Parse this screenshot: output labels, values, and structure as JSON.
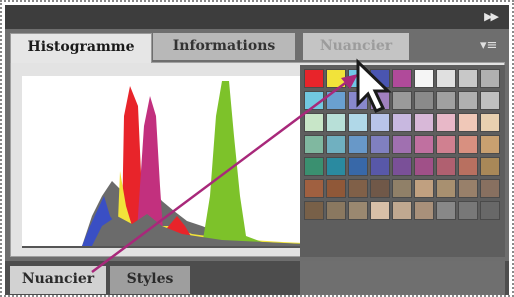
{
  "panel": {
    "collapse_icon": "double-chevron-right-icon",
    "menu_icon": "panel-menu-icon",
    "tabs": [
      {
        "label": "Histogramme",
        "active": true
      },
      {
        "label": "Informations",
        "active": false
      },
      {
        "label": "Nuancier",
        "active": false,
        "dragging": true
      }
    ]
  },
  "bottom_panel": {
    "tabs": [
      {
        "label": "Nuancier",
        "active": true
      },
      {
        "label": "Styles",
        "active": false
      }
    ]
  },
  "histogram": {
    "channels": [
      {
        "name": "red",
        "color": "#e8242a"
      },
      {
        "name": "green",
        "color": "#7dc22a"
      },
      {
        "name": "blue",
        "color": "#3a4fc4"
      },
      {
        "name": "magenta",
        "color": "#c2307e"
      },
      {
        "name": "yellow",
        "color": "#f2e33a"
      },
      {
        "name": "gray",
        "color": "#6b6b6b"
      }
    ]
  },
  "swatches": {
    "rows": [
      [
        "#e8242a",
        "#f2e33a",
        "#70c7e8",
        "#4a55b0",
        "#b04a9a",
        "#f5f5f5",
        "#e0e0e0",
        "#c8c8c8",
        "#b0b0b0"
      ],
      [
        "#71c8e0",
        "#6aa0d0",
        "#8888cc",
        "#a080c0",
        "#9a9a9a",
        "#8a8a8a",
        "#a0a0a0",
        "#b0b0b0",
        "#c0c0c0"
      ],
      [
        "#c8e6c8",
        "#b8e0d8",
        "#b0d8e8",
        "#b8c4e8",
        "#c8b8e0",
        "#d8b8d8",
        "#e8b8c8",
        "#f0c8b8",
        "#e8d0b0"
      ],
      [
        "#80b8a0",
        "#70b0c0",
        "#6898c8",
        "#8080c0",
        "#a070b0",
        "#c070a0",
        "#d08090",
        "#d89080",
        "#c8a070"
      ],
      [
        "#3a9070",
        "#2a8aa0",
        "#3868a8",
        "#5858a8",
        "#7a5098",
        "#a05088",
        "#b06070",
        "#b87060",
        "#a88858"
      ],
      [
        "#a06040",
        "#905838",
        "#806048",
        "#705848",
        "#908068",
        "#c0a080",
        "#a89070",
        "#98806a",
        "#887060"
      ],
      [
        "#786048",
        "#8a7860",
        "#9a8870",
        "#d8c0a8",
        "#c0a890",
        "#a8907a",
        "#888888",
        "#787878",
        "#686868"
      ]
    ]
  },
  "cursor": {
    "icon": "arrow-cursor-icon",
    "path": "drag-arrow"
  }
}
